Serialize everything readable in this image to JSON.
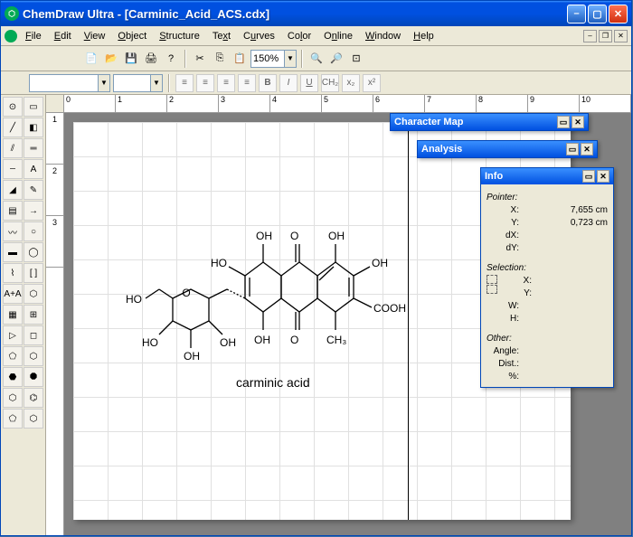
{
  "window": {
    "app_name": "ChemDraw Ultra",
    "document": "[Carminic_Acid_ACS.cdx]",
    "title": "ChemDraw Ultra - [Carminic_Acid_ACS.cdx]"
  },
  "menus": [
    "File",
    "Edit",
    "View",
    "Object",
    "Structure",
    "Text",
    "Curves",
    "Color",
    "Online",
    "Window",
    "Help"
  ],
  "toolbar": {
    "zoom": "150%",
    "icons": [
      "new-icon",
      "open-icon",
      "save-icon",
      "print-icon",
      "help-icon",
      "cut-icon",
      "copy-icon",
      "paste-icon"
    ],
    "zoom_icons": [
      "zoom-in-icon",
      "zoom-out-icon",
      "zoom-fit-icon"
    ]
  },
  "format_bar": {
    "buttons": [
      "align-left",
      "align-center",
      "align-right",
      "justify",
      "B",
      "I",
      "U",
      "CH₂",
      "x₂",
      "x²"
    ]
  },
  "ruler_h": [
    "0",
    "1",
    "2",
    "3",
    "4",
    "5",
    "6",
    "7",
    "8",
    "9",
    "10"
  ],
  "ruler_v": [
    "1",
    "2",
    "3"
  ],
  "molecule": {
    "name": "carminic acid",
    "atom_labels": [
      "OH",
      "OH",
      "O",
      "HO",
      "O",
      "OH",
      "O",
      "OH",
      "OH",
      "O",
      "CH₃",
      "COOH",
      "HO",
      "O",
      "HO",
      "OH",
      "OH"
    ]
  },
  "panels": {
    "charmap": {
      "title": "Character Map"
    },
    "analysis": {
      "title": "Analysis"
    },
    "info": {
      "title": "Info",
      "pointer_hdr": "Pointer:",
      "x_label": "X:",
      "x_val": "7,655 cm",
      "y_label": "Y:",
      "y_val": "0,723 cm",
      "dx_label": "dX:",
      "dx_val": "",
      "dy_label": "dY:",
      "dy_val": "",
      "selection_hdr": "Selection:",
      "sx_label": "X:",
      "sx_val": "",
      "sy_label": "Y:",
      "sy_val": "",
      "w_label": "W:",
      "w_val": "",
      "h_label": "H:",
      "h_val": "",
      "other_hdr": "Other:",
      "angle_label": "Angle:",
      "angle_val": "",
      "dist_label": "Dist.:",
      "dist_val": "",
      "pct_label": "%:",
      "pct_val": ""
    }
  }
}
